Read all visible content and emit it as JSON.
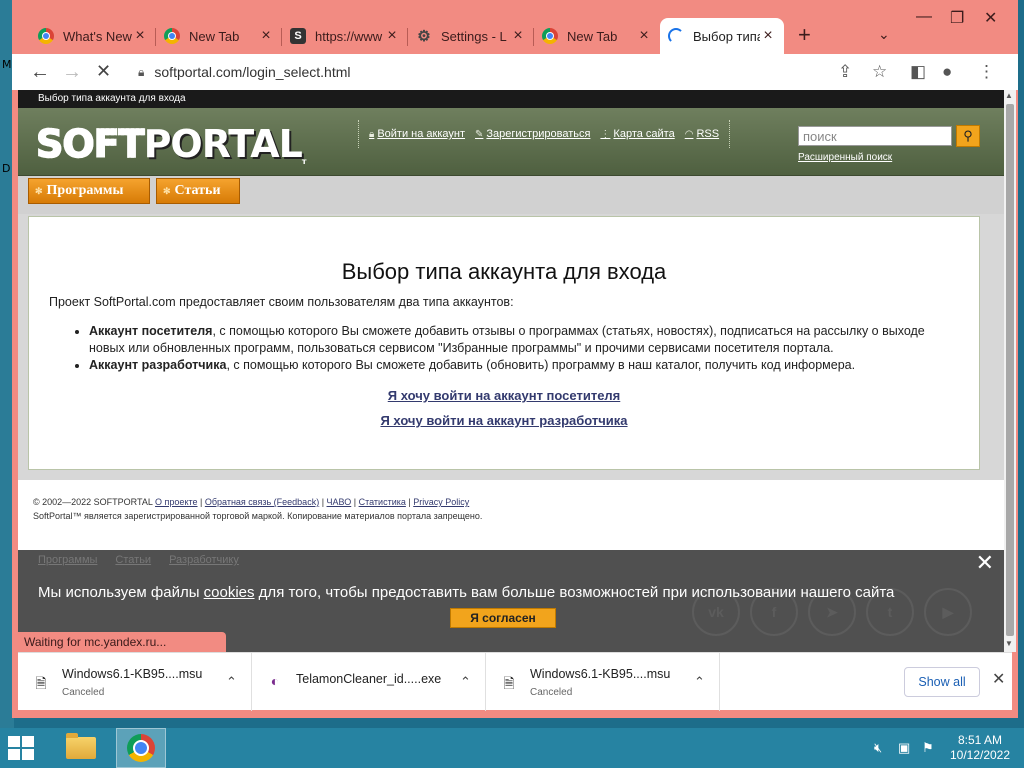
{
  "desktop": {
    "edge_labels": [
      "M",
      "D"
    ]
  },
  "tabs": [
    {
      "title": "What's New",
      "favicon": "chrome-icon",
      "active": false
    },
    {
      "title": "New Tab",
      "favicon": "chrome-icon",
      "active": false
    },
    {
      "title": "https://www",
      "favicon": "softportal-s-icon",
      "active": false
    },
    {
      "title": "Settings - L",
      "favicon": "gear-icon",
      "active": false
    },
    {
      "title": "New Tab",
      "favicon": "chrome-icon",
      "active": false
    },
    {
      "title": "Выбор типа",
      "favicon": "loading-spinner-icon",
      "active": true
    }
  ],
  "toolbar": {
    "url": "softportal.com/login_select.html"
  },
  "site": {
    "top_label": "Выбор типа аккаунта для входа",
    "logo_soft": "SOFT",
    "logo_portal": "PORTAL",
    "logo_tm": "т",
    "header_links": [
      "Войти на аккаунт",
      "Зарегистрироваться",
      "Карта сайта",
      "RSS"
    ],
    "search_placeholder": "поиск",
    "advanced_search": "Расширенный поиск",
    "menu": [
      "Программы",
      "Статьи"
    ]
  },
  "content": {
    "heading": "Выбор типа аккаунта для входа",
    "intro": "Проект SoftPortal.com предоставляет своим пользователям два типа аккаунтов:",
    "items": [
      {
        "bold": "Аккаунт посетителя",
        "text": ", с помощью которого Вы сможете добавить отзывы о программах (статьях, новостях), подписаться на рассылку о выходе новых или обновленных программ, пользоваться сервисом \"Избранные программы\" и прочими сервисами посетителя портала."
      },
      {
        "bold": "Аккаунт разработчика",
        "text": ", с помощью которого Вы сможете добавить (обновить) программу в наш каталог, получить код информера."
      }
    ],
    "visitor_link": "Я хочу войти на аккаунт посетителя",
    "developer_link": "Я хочу войти на аккаунт разработчика"
  },
  "footer": {
    "copyright": "© 2002—2022 SOFTPORTAL",
    "links": [
      "О проекте",
      "Обратная связь (Feedback)",
      "ЧАВО",
      "Статистика",
      "Privacy Policy"
    ],
    "trademark": "SoftPortal™ является зарегистрированной торговой маркой. Копирование материалов портала запрещено.",
    "bottom_links": [
      "Программы",
      "Статьи",
      "Разработчику"
    ]
  },
  "cookie": {
    "text_before": "Мы используем файлы ",
    "link": "cookies",
    "text_after": " для того, чтобы предоставить вам больше возможностей при использовании нашего сайта",
    "button": "Я согласен",
    "social": [
      "vk-icon",
      "facebook-icon",
      "telegram-icon",
      "twitter-icon",
      "youtube-icon"
    ]
  },
  "status_bar": "Waiting for mc.yandex.ru...",
  "downloads": [
    {
      "name": "Windows6.1-KB95....msu",
      "status": "Canceled"
    },
    {
      "name": "TelamonCleaner_id.....exe",
      "status": ""
    },
    {
      "name": "Windows6.1-KB95....msu",
      "status": "Canceled"
    }
  ],
  "show_all": "Show all",
  "clock": {
    "time": "8:51 AM",
    "date": "10/12/2022"
  },
  "colors": {
    "tab_strip": "#f28b82",
    "taskbar": "#2683a2",
    "accent": "#f2a41c",
    "header": "#5f6f4e"
  }
}
